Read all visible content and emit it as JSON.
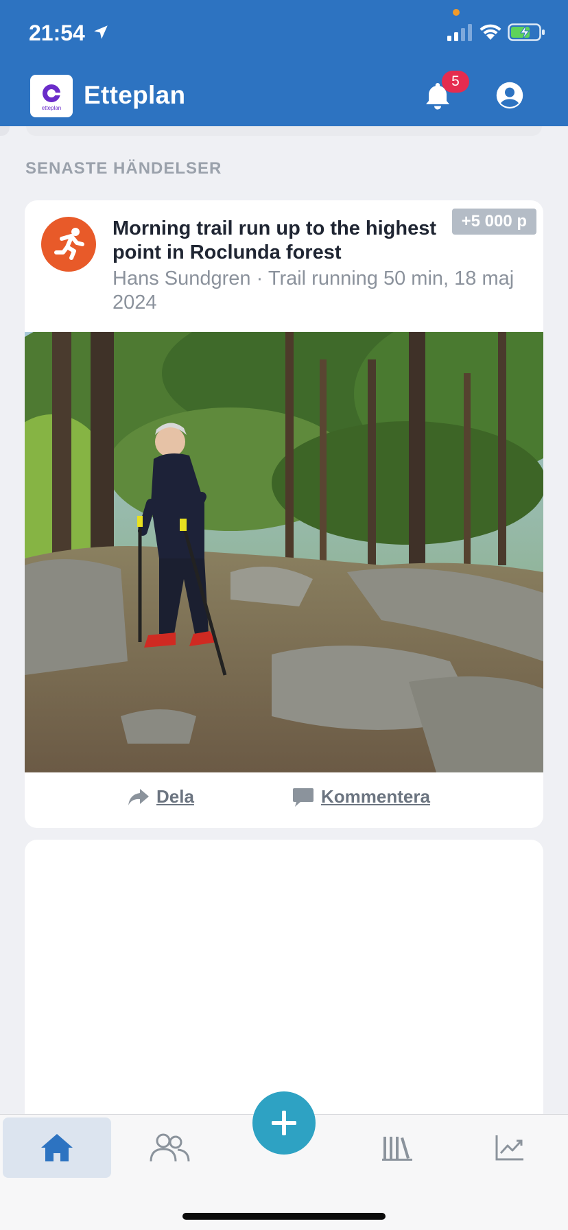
{
  "status_bar": {
    "time": "21:54"
  },
  "header": {
    "app_title": "Etteplan",
    "logo_text": "etteplan",
    "notification_count": "5"
  },
  "feed": {
    "section_label": "SENASTE HÄNDELSER",
    "post": {
      "title": "Morning trail run up to the highest point in Roclunda forest",
      "author": "Hans Sundgren",
      "meta_separator": "·",
      "meta_detail": "Trail running 50 min, 18 maj 2024",
      "points": "+5 000 p",
      "share_label": "Dela",
      "comment_label": "Kommentera"
    }
  },
  "bottom_nav": {
    "items": [
      "home",
      "people",
      "add",
      "library",
      "stats"
    ],
    "active": "home"
  },
  "colors": {
    "header_bg": "#2d73c1",
    "accent_orange": "#e85a29",
    "fab": "#2ea2c3",
    "badge_red": "#e52c4f"
  }
}
